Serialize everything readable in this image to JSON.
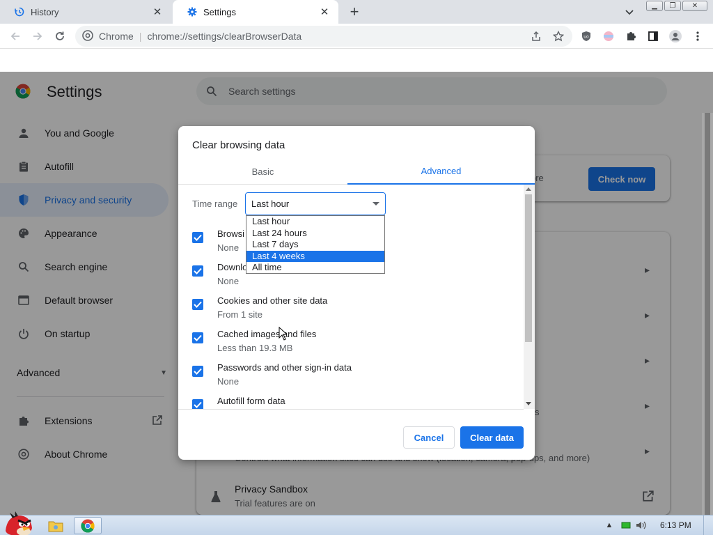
{
  "browser": {
    "tabs": [
      {
        "title": "History",
        "icon": "history-icon",
        "active": false
      },
      {
        "title": "Settings",
        "icon": "gear-icon",
        "active": true
      }
    ],
    "omnibox": {
      "site_chip": "Chrome",
      "url": "chrome://settings/clearBrowserData"
    }
  },
  "settings": {
    "title": "Settings",
    "search_placeholder": "Search settings",
    "nav": [
      {
        "label": "You and Google",
        "icon": "person-icon"
      },
      {
        "label": "Autofill",
        "icon": "clipboard-icon"
      },
      {
        "label": "Privacy and security",
        "icon": "shield-icon",
        "selected": true
      },
      {
        "label": "Appearance",
        "icon": "palette-icon"
      },
      {
        "label": "Search engine",
        "icon": "search-icon"
      },
      {
        "label": "Default browser",
        "icon": "browser-window-icon"
      },
      {
        "label": "On startup",
        "icon": "power-icon"
      }
    ],
    "advanced_label": "Advanced",
    "extensions_label": "Extensions",
    "about_label": "About Chrome",
    "safety_check": {
      "partial_text": "ore",
      "button": "Check now"
    },
    "bg_fragments": {
      "frag_s": "s",
      "site_settings_desc": "Controls what information sites can use and show (location, camera, pop-ups, and more)"
    },
    "privacy_sandbox": {
      "title": "Privacy Sandbox",
      "subtitle": "Trial features are on"
    }
  },
  "dialog": {
    "title": "Clear browsing data",
    "tabs": {
      "basic": "Basic",
      "advanced": "Advanced"
    },
    "time_range_label": "Time range",
    "time_range_value": "Last hour",
    "time_range_options": [
      "Last hour",
      "Last 24 hours",
      "Last 7 days",
      "Last 4 weeks",
      "All time"
    ],
    "highlighted_option": "Last 4 weeks",
    "items": [
      {
        "label": "Browsing history",
        "visible_label": "Browsi",
        "sub": "None",
        "checked": true
      },
      {
        "label": "Download history",
        "visible_label": "Downlo",
        "sub": "None",
        "checked": true
      },
      {
        "label": "Cookies and other site data",
        "sub": "From 1 site",
        "checked": true
      },
      {
        "label": "Cached images and files",
        "sub": "Less than 19.3 MB",
        "checked": true
      },
      {
        "label": "Passwords and other sign-in data",
        "sub": "None",
        "checked": true
      },
      {
        "label": "Autofill form data",
        "sub": "",
        "checked": true
      }
    ],
    "cancel_label": "Cancel",
    "clear_label": "Clear data"
  },
  "taskbar": {
    "clock": "6:13 PM"
  },
  "colors": {
    "accent": "#1a73e8",
    "tab_strip": "#dee1e6",
    "nav_selected_bg": "#e8f0fe",
    "scrim": "rgba(0,0,0,0.4)"
  }
}
